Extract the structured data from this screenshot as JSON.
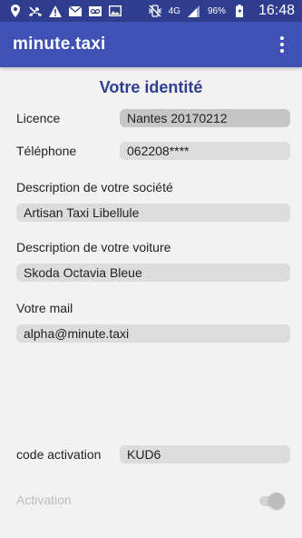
{
  "status_bar": {
    "network_label": "4G",
    "battery": "96%",
    "time": "16:48",
    "icons": [
      "location-icon",
      "missed-call-icon",
      "warning-icon",
      "mail-icon",
      "voicemail-icon",
      "photo-icon",
      "vibrate-icon",
      "signal-icon",
      "battery-icon"
    ]
  },
  "app_bar": {
    "title": "minute.taxi",
    "menu_icon": "overflow-menu-icon"
  },
  "page": {
    "title": "Votre identité"
  },
  "form": {
    "licence": {
      "label": "Licence",
      "value": "Nantes 20170212"
    },
    "telephone": {
      "label": "Téléphone",
      "value": "062208****"
    },
    "societe": {
      "label": "Description de votre société",
      "value": "Artisan Taxi Libellule"
    },
    "voiture": {
      "label": "Description de votre voiture",
      "value": "Skoda Octavia Bleue"
    },
    "mail": {
      "label": "Votre mail",
      "value": "alpha@minute.taxi"
    },
    "activation_code": {
      "label": "code activation",
      "value": "KUD6"
    },
    "activation": {
      "label": "Activation",
      "enabled": false,
      "checked": true
    }
  },
  "colors": {
    "status_bar": "#2f3d8f",
    "app_bar": "#3f51b5",
    "title": "#2f3d8f",
    "background": "#f2f2f2"
  }
}
